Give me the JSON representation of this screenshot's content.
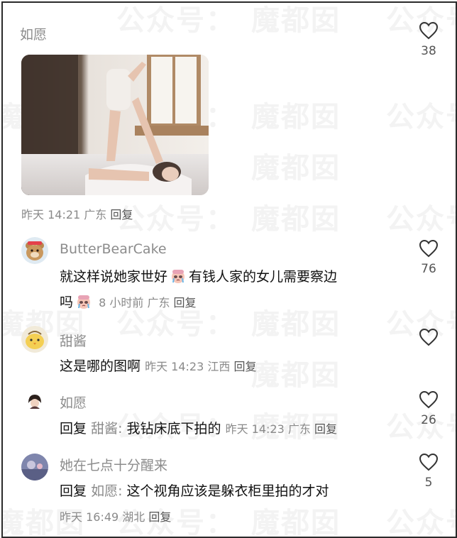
{
  "watermarks": [
    "公众号：",
    "魔都囡",
    "公众号：",
    "魔都囡",
    "公众号：",
    "魔都囡",
    "公众号：",
    "魔都囡",
    "公众号：",
    "魔都囡",
    "公众号：",
    "魔都囡",
    "公众号：",
    "魔都囡",
    "公众号：",
    "魔都囡",
    "公众号：",
    "魔都囡"
  ],
  "comments": [
    {
      "name": "如愿",
      "time": "昨天 14:21",
      "location": "广东",
      "reply_label": "回复",
      "likes": "38"
    },
    {
      "name": "ButterBearCake",
      "text_line1": "就这样说她家世好",
      "text_line1b": "有钱人家的女儿需要察边",
      "text_line2": "吗",
      "time": "8 小时前",
      "location": "广东",
      "reply_label": "回复",
      "likes": "76"
    },
    {
      "name": "甜酱",
      "text": "这是哪的图啊",
      "time": "昨天 14:23",
      "location": "江西",
      "reply_label": "回复",
      "likes": ""
    },
    {
      "name": "如愿",
      "reply_prefix": "回复",
      "reply_target": "甜酱:",
      "text": "我钻床底下拍的",
      "time": "昨天 14:23",
      "location": "广东",
      "reply_label": "回复",
      "likes": "26"
    },
    {
      "name": "她在七点十分醒来",
      "reply_prefix": "回复",
      "reply_target": "如愿:",
      "text": "这个视角应该是躲衣柜里拍的才对",
      "time": "昨天 16:49",
      "location": "湖北",
      "reply_label": "回复",
      "likes": "5"
    }
  ],
  "icons": {
    "like": "heart-outline-icon",
    "emoji": "crying-face-emoji"
  }
}
